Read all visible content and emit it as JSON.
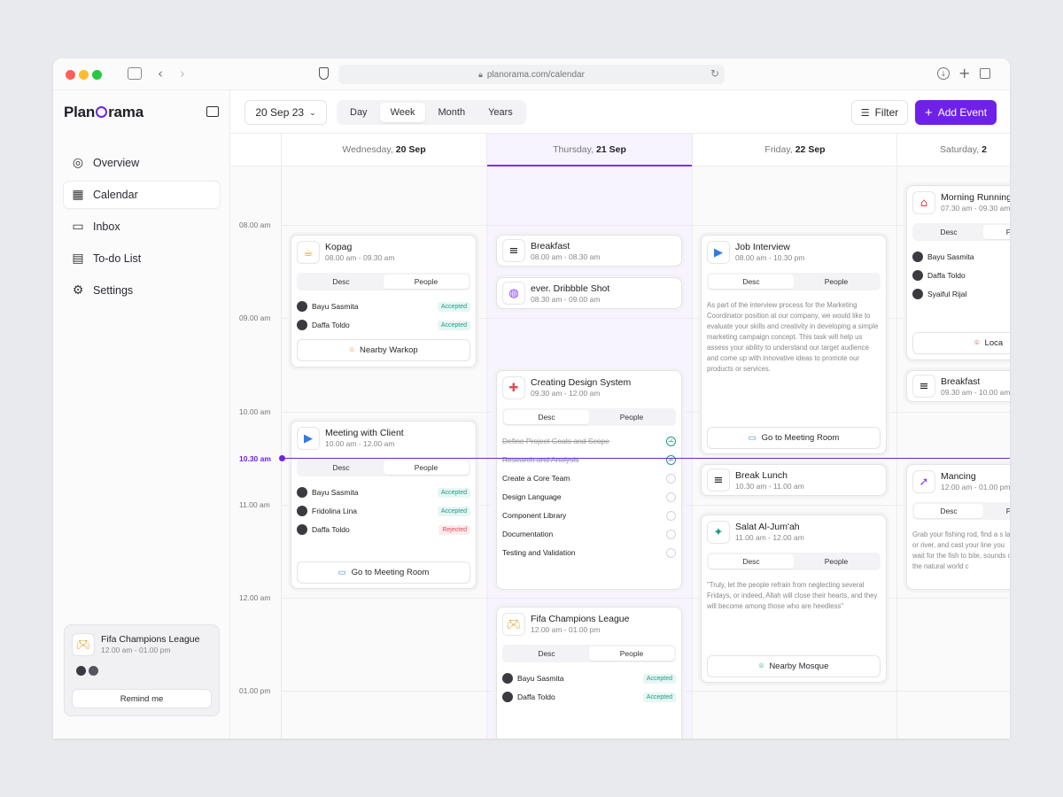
{
  "browser": {
    "url": "planorama.com/calendar"
  },
  "app": {
    "logo_a": "Plan",
    "logo_b": "rama"
  },
  "sidebar": {
    "items": [
      {
        "label": "Overview",
        "icon": "compass-icon"
      },
      {
        "label": "Calendar",
        "icon": "calendar-icon",
        "active": true
      },
      {
        "label": "Inbox",
        "icon": "inbox-icon"
      },
      {
        "label": "To-do List",
        "icon": "clipboard-icon"
      },
      {
        "label": "Settings",
        "icon": "gear-icon"
      }
    ],
    "promo": {
      "title": "Fifa Champions League",
      "time": "12.00 am - 01.00 pm",
      "button": "Remind me"
    }
  },
  "toolbar": {
    "date": "20 Sep 23",
    "views": [
      "Day",
      "Week",
      "Month",
      "Years"
    ],
    "active_view": "Week",
    "filter": "Filter",
    "add_event": "Add Event",
    "accent": "#6f21e8"
  },
  "days": [
    {
      "weekday": "Wednesday,",
      "date": "20 Sep"
    },
    {
      "weekday": "Thursday,",
      "date": "21 Sep"
    },
    {
      "weekday": "Friday,",
      "date": "22 Sep"
    },
    {
      "weekday": "Saturday,",
      "date": "2"
    }
  ],
  "times": [
    "08.00 am",
    "09.00 am",
    "10.00 am",
    "10.30 am",
    "11.00 am",
    "12.00 am",
    "01.00 pm"
  ],
  "tabs": {
    "desc": "Desc",
    "people": "People"
  },
  "status": {
    "accepted": "Accepted",
    "rejected": "Rejected"
  },
  "events": {
    "kopag": {
      "title": "Kopag",
      "time": "08.00 am - 09.30 am",
      "people": [
        "Bayu Sasmita",
        "Daffa Toldo"
      ],
      "button": "Nearby Warkop"
    },
    "meeting": {
      "title": "Meeting with Client",
      "time": "10.00 am - 12.00 am",
      "people": [
        "Bayu Sasmita",
        "Fridolina Lina",
        "Daffa Toldo"
      ],
      "button": "Go to Meeting Room"
    },
    "breakfast": {
      "title": "Breakfast",
      "time": "08.00 am - 08.30 am"
    },
    "dribbble": {
      "title": "ever. Dribbble Shot",
      "time": "08.30 am - 09.00 am"
    },
    "design": {
      "title": "Creating Design System",
      "time": "09.30 am - 12.00 am",
      "todos": [
        "Define Project Goals and Scope",
        "Research and Analysis",
        "Create a Core Team",
        "Design Language",
        "Component Library",
        "Documentation",
        "Testing and Validation"
      ]
    },
    "fifa": {
      "title": "Fifa Champions League",
      "time": "12.00 am - 01.00 pm",
      "people": [
        "Bayu Sasmita",
        "Daffa Toldo"
      ]
    },
    "interview": {
      "title": "Job Interview",
      "time": "08.00 am - 10.30 pm",
      "desc": "As part of the interview process for the Marketing Coordinator position at our company, we would like to evaluate your skills and creativity in developing a simple marketing campaign concept. This task will help us assess your ability to understand our target audience and come up with innovative ideas to promote our products or services.",
      "button": "Go to Meeting Room"
    },
    "lunch": {
      "title": "Break Lunch",
      "time": "10.30 am - 11.00 am"
    },
    "salat": {
      "title": "Salat Al-Jum'ah",
      "time": "11.00 am - 12.00 am",
      "desc": "\"Truly, let the people refrain from neglecting several Fridays, or indeed, Allah will close their hearts, and they will become among those who are heedless\"",
      "button": "Nearby Mosque"
    },
    "running": {
      "title": "Morning Running",
      "time": "07.30 am - 09.30 am",
      "people": [
        "Bayu Sasmita",
        "Daffa Toldo",
        "Syaiful Rijal"
      ],
      "button": "Loca"
    },
    "breakfast2": {
      "title": "Breakfast",
      "time": "09.30 am - 10.00 am"
    },
    "mancing": {
      "title": "Mancing",
      "time": "12.00 am - 01.00 pm",
      "desc": "Grab your fishing rod, find a s lake or river, and cast your line you wait for the fish to bite, sounds of the natural world c"
    }
  }
}
